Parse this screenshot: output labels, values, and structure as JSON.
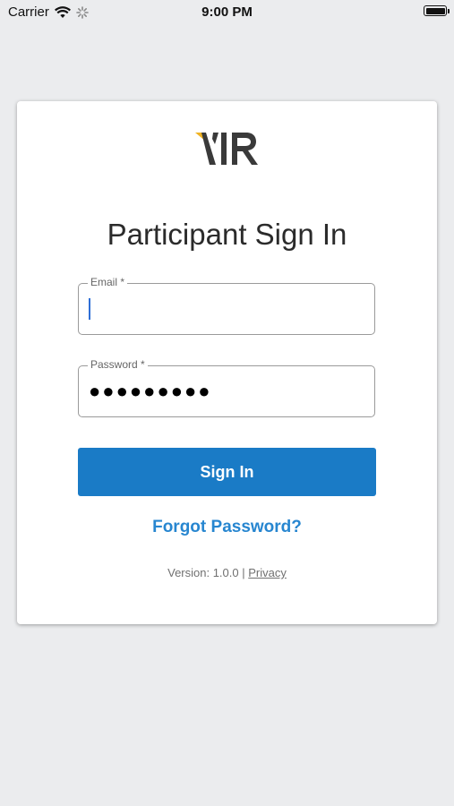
{
  "status_bar": {
    "carrier": "Carrier",
    "time": "9:00 PM",
    "battery_level": 1.0
  },
  "login": {
    "title": "Participant Sign In",
    "email_label": "Email *",
    "email_value": "",
    "password_label": "Password *",
    "password_masked": "●●●●●●●●●",
    "sign_in_label": "Sign In",
    "forgot_label": "Forgot Password?",
    "version_text": "Version: 1.0.0",
    "separator": "|",
    "privacy_label": "Privacy"
  },
  "colors": {
    "background": "#ebecee",
    "primary_button": "#1a7bc6",
    "link": "#2786d0",
    "logo_accent": "#f0b323",
    "logo_dark": "#3a3a3a"
  },
  "icons": [
    "wifi-icon",
    "activity-spinner-icon",
    "battery-icon",
    "vir-logo"
  ]
}
